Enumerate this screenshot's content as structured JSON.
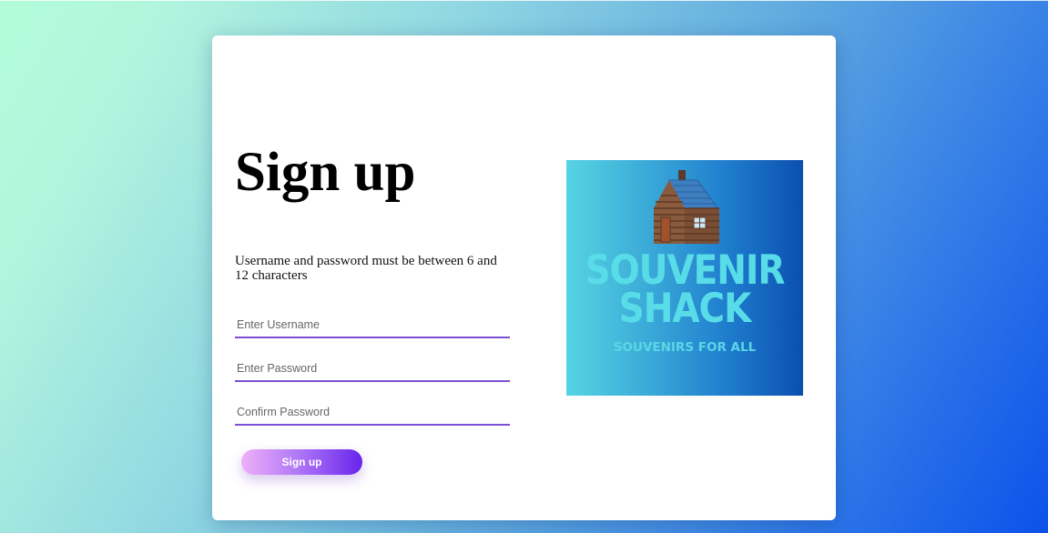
{
  "form": {
    "title": "Sign up",
    "hint": "Username and password must be between 6 and 12 characters",
    "username_placeholder": "Enter Username",
    "password_placeholder": "Enter Password",
    "confirm_placeholder": "Confirm Password",
    "submit_label": "Sign up"
  },
  "logo": {
    "line1": "SOUVENIR",
    "line2": "SHACK",
    "tagline": "SOUVENIRS FOR ALL",
    "icon": "log-cabin-icon"
  },
  "colors": {
    "field_underline": "#7b4fd6",
    "button_gradient_start": "#eeb0f8",
    "button_gradient_end": "#6a24ec",
    "logo_text": "#58dde8"
  }
}
